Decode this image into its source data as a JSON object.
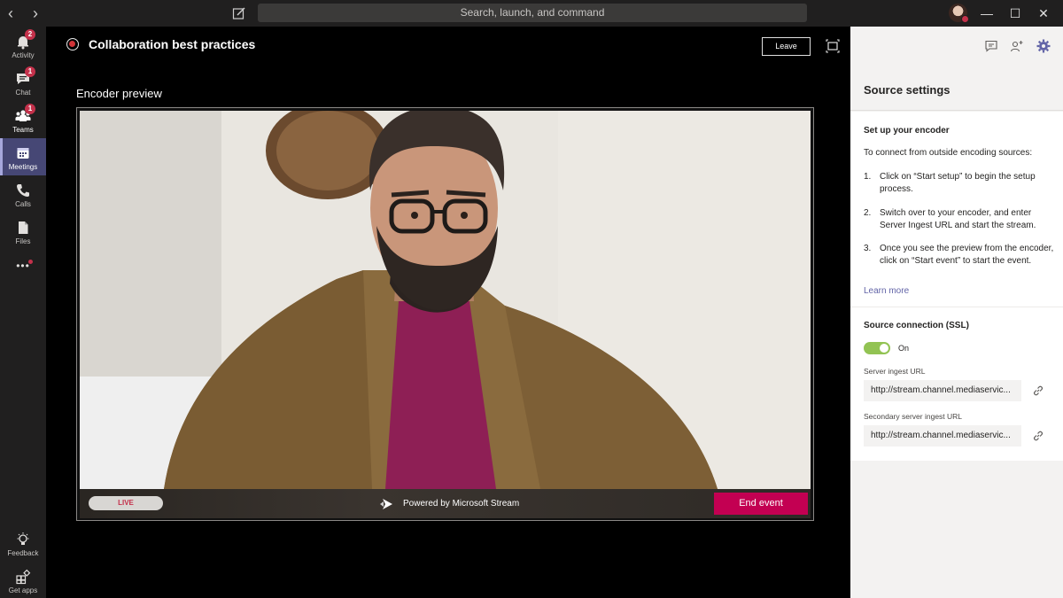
{
  "titlebar": {
    "back_icon": "chevron-left-icon",
    "forward_icon": "chevron-right-icon",
    "compose_icon": "compose-icon",
    "search_placeholder": "Search, launch, and command",
    "minimize": "—",
    "maximize": "☐",
    "close": "✕"
  },
  "rail": {
    "items": [
      {
        "label": "Activity",
        "icon": "bell-icon",
        "badge": "2"
      },
      {
        "label": "Chat",
        "icon": "chat-icon",
        "badge": "1"
      },
      {
        "label": "Teams",
        "icon": "teams-icon",
        "badge": "1"
      },
      {
        "label": "Meetings",
        "icon": "calendar-icon",
        "badge": ""
      },
      {
        "label": "Calls",
        "icon": "phone-icon",
        "badge": ""
      },
      {
        "label": "Files",
        "icon": "file-icon",
        "badge": ""
      }
    ],
    "more": "•••",
    "bottom": [
      {
        "label": "Feedback",
        "icon": "lightbulb-icon"
      },
      {
        "label": "Get apps",
        "icon": "apps-icon"
      }
    ],
    "active": "Meetings"
  },
  "main": {
    "event_title": "Collaboration best practices",
    "leave_label": "Leave",
    "preview_title": "Encoder preview",
    "live_label": "LIVE",
    "powered_by": "Powered by Microsoft Stream",
    "end_event_label": "End event"
  },
  "panel": {
    "title": "Source settings",
    "setup_heading": "Set up your encoder",
    "setup_intro": "To connect from outside encoding sources:",
    "steps": [
      {
        "num": "1.",
        "text": "Click on “Start setup” to begin the setup process."
      },
      {
        "num": "2.",
        "text": "Switch over to your encoder, and enter Server Ingest URL and start the stream."
      },
      {
        "num": "3.",
        "text": "Once you see the preview from the encoder, click on “Start event” to start the event."
      }
    ],
    "learn_more": "Learn more",
    "connection_heading": "Source connection (SSL)",
    "toggle_label": "On",
    "server_label": "Server ingest URL",
    "server_url": "http://stream.channel.mediaservic...",
    "secondary_label": "Secondary server ingest URL",
    "secondary_url": "http://stream.channel.mediaservic..."
  },
  "colors": {
    "accent": "#6264a7",
    "end_event": "#c30052",
    "badge": "#c4314b",
    "toggle_on": "#92c353"
  }
}
